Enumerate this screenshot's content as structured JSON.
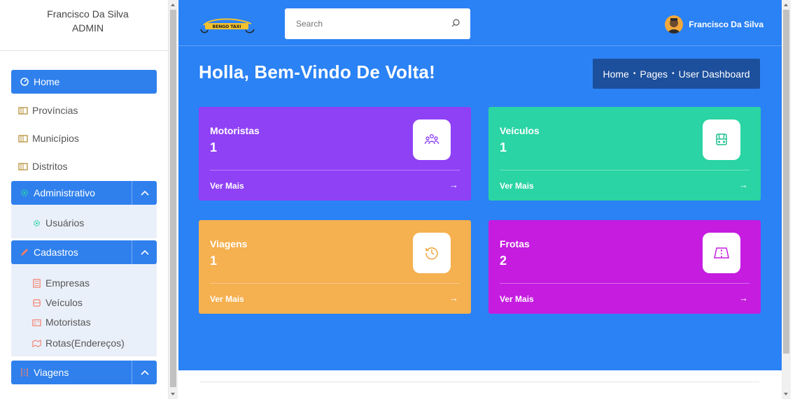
{
  "user": {
    "name": "Francisco Da Silva",
    "role": "ADMIN"
  },
  "sidebar": {
    "home": "Home",
    "items": [
      "Províncias",
      "Municípios",
      "Distritos"
    ],
    "administrativo": {
      "label": "Administrativo",
      "children": [
        "Usuários"
      ]
    },
    "cadastros": {
      "label": "Cadastros",
      "children": [
        "Empresas",
        "Veículos",
        "Motoristas",
        "Rotas(Endereços)"
      ]
    },
    "viagens": {
      "label": "Viagens"
    }
  },
  "header": {
    "logo_text": "BENGO TAXI",
    "search_placeholder": "Search",
    "profile_name": "Francisco Da Silva"
  },
  "page": {
    "title": "Holla, Bem-Vindo De Volta!",
    "breadcrumb": [
      "Home",
      "Pages",
      "User Dashboard"
    ]
  },
  "cards": [
    {
      "label": "Motoristas",
      "count": "1",
      "link": "Ver Mais",
      "arrow": "→",
      "color": "#8f41f6",
      "icon": "users-icon",
      "iconColor": "#8f41f6"
    },
    {
      "label": "Veículos",
      "count": "1",
      "link": "Ver Mais",
      "arrow": "→",
      "color": "#2ad4a4",
      "icon": "car-icon",
      "iconColor": "#1fbf8f"
    },
    {
      "label": "Viagens",
      "count": "1",
      "link": "Ver Mais",
      "arrow": "→",
      "color": "#f5b04f",
      "icon": "history-icon",
      "iconColor": "#f0a33a"
    },
    {
      "label": "Frotas",
      "count": "2",
      "link": "Ver Mais",
      "arrow": "→",
      "color": "#c51ce0",
      "icon": "map-icon",
      "iconColor": "#c51ce0"
    }
  ],
  "colors": {
    "primary": "#2b82f4",
    "breadcrumb_bg": "#1c4f9c"
  }
}
